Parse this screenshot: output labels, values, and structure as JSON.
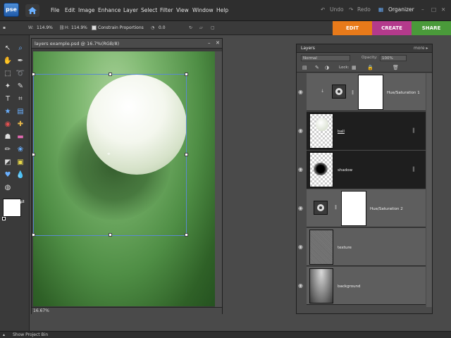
{
  "app": {
    "logo": "pse"
  },
  "menu": [
    "File",
    "Edit",
    "Image",
    "Enhance",
    "Layer",
    "Select",
    "Filter",
    "View",
    "Window",
    "Help"
  ],
  "top_right": {
    "undo": "Undo",
    "redo": "Redo",
    "organizer": "Organizer"
  },
  "options": {
    "w_label": "W:",
    "w_value": "114.9%",
    "h_label": "H:",
    "h_value": "114.9%",
    "constrain": "Constrain Proportions",
    "angle_value": "0.0"
  },
  "modes": [
    {
      "label": "EDIT",
      "color": "#e87a1a"
    },
    {
      "label": "CREATE",
      "color": "#b43a8c"
    },
    {
      "label": "SHARE",
      "color": "#4a9a3a"
    }
  ],
  "document": {
    "title": "layers example.psd @ 16.7%(RGB/8)",
    "zoom": "16.67%"
  },
  "layers_panel": {
    "tab": "Layers",
    "more": "more ▸",
    "blend_mode": "Normal",
    "opacity_label": "Opacity:",
    "opacity_value": "100%",
    "lock_label": "Lock:",
    "layers": [
      {
        "name": "Hue/Saturation 1",
        "kind": "adjustment",
        "selected": false
      },
      {
        "name": "ball",
        "kind": "pixel",
        "selected": true
      },
      {
        "name": "shadow",
        "kind": "pixel",
        "selected": true
      },
      {
        "name": "Hue/Saturation 2",
        "kind": "adjustment",
        "selected": false
      },
      {
        "name": "texture",
        "kind": "pixel",
        "selected": false
      },
      {
        "name": "background",
        "kind": "pixel",
        "selected": false
      }
    ]
  },
  "project_bin": "Show Project Bin"
}
